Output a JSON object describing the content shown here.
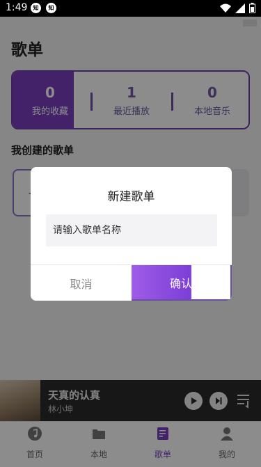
{
  "status_bar": {
    "time": "1:49",
    "app_badge_1": "知",
    "app_badge_2": "知"
  },
  "page": {
    "title": "歌单",
    "stats": [
      {
        "count": "0",
        "label": "我的收藏"
      },
      {
        "count": "1",
        "label": "最近播放"
      },
      {
        "count": "0",
        "label": "本地音乐"
      }
    ],
    "section_title": "我创建的歌单",
    "add_symbol": "+"
  },
  "player": {
    "song": "天真的认真",
    "artist": "林小坤"
  },
  "tabs": [
    {
      "label": "首页",
      "icon": "music-note-icon"
    },
    {
      "label": "本地",
      "icon": "folder-icon"
    },
    {
      "label": "歌单",
      "icon": "playlist-icon"
    },
    {
      "label": "我的",
      "icon": "user-icon"
    }
  ],
  "active_tab": "歌单",
  "dialog": {
    "title": "新建歌单",
    "input_placeholder": "请输入歌单名称",
    "cancel_label": "取消",
    "confirm_label": "确认"
  },
  "colors": {
    "accent": "#7a3fc2",
    "overlay": "#000000"
  }
}
